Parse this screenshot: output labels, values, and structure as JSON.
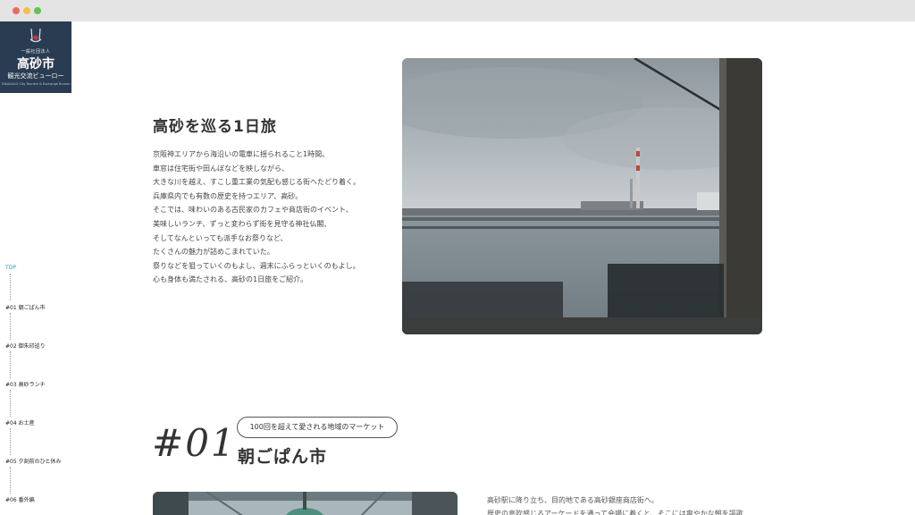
{
  "logo": {
    "org": "一般社団法人",
    "city": "高砂市",
    "bureau": "観光交流ビューロー",
    "tagline_en": "TAKASAGO City Tourism & Exchange Bureau"
  },
  "nav": {
    "top": "TOP",
    "items": [
      "#01 朝ごぱん市",
      "#02 御朱印巡り",
      "#03 高砂ランチ",
      "#04 お土産",
      "#05 夕刻前のひと休み",
      "#06 番外編"
    ]
  },
  "hero": {
    "title": "高砂を巡る1日旅",
    "paragraph": [
      "京阪神エリアから海沿いの電車に揺られること1時間。",
      "車窓は住宅街や田んぼなどを映しながら、",
      "大きな川を越え、すこし重工業の気配も感じる街へたどり着く。",
      "兵庫県内でも有数の歴史を持つエリア、高砂。",
      "そこでは、味わいのある古民家のカフェや商店街のイベント、",
      "美味しいランチ、ずっと変わらず街を見守る神社仏閣、",
      "そしてなんといっても派手なお祭りなど、",
      "たくさんの魅力が詰めこまれていた。",
      "祭りなどを狙っていくのもよし、週末にふらっといくのもよし。",
      "心も身体も満たされる、高砂の1日旅をご紹介。"
    ]
  },
  "section1": {
    "number": "#01",
    "badge": "100回を超えて愛される地域のマーケット",
    "title": "朝ごぱん市",
    "text": [
      "高砂駅に降り立ち、目的地である高砂銀座商店街へ。",
      "歴史の息吹感じるアーケードを通って会場に着くと、そこには爽やかな朝を謳歌"
    ]
  },
  "colors": {
    "logo_bg": "#2a3c52",
    "nav_active": "#2aa1b7"
  }
}
